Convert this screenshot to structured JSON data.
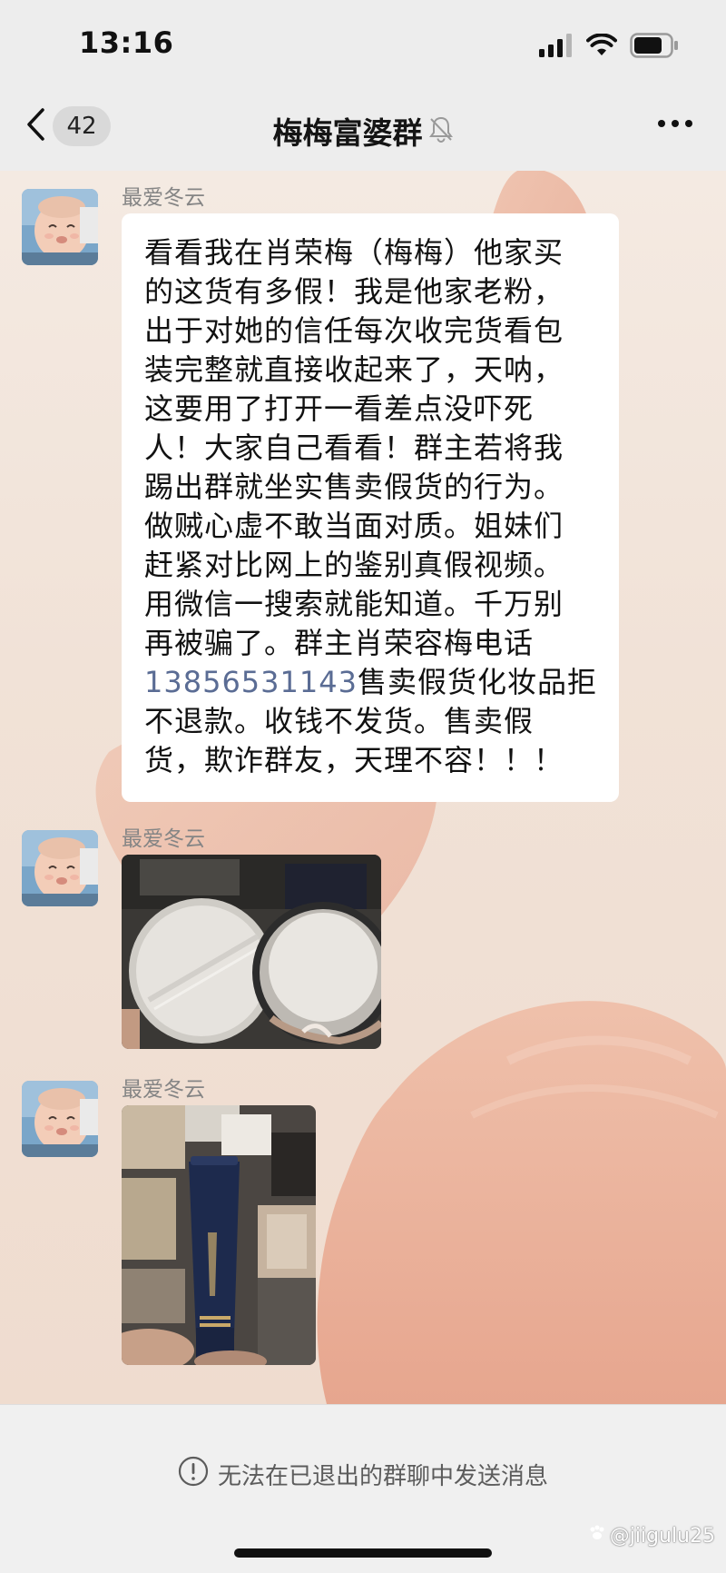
{
  "status_bar": {
    "time": "13:16"
  },
  "nav": {
    "back_count": "42",
    "title": "梅梅富婆群"
  },
  "messages": [
    {
      "sender": "最爱冬云",
      "type": "text",
      "lines": [
        "看看我在肖荣梅（梅梅）他家买",
        "的这货有多假！我是他家老粉，",
        "出于对她的信任每次收完货看包",
        "装完整就直接收起来了，天呐，",
        "这要用了打开一看差点没吓死",
        "人！大家自己看看！群主若将我",
        "踢出群就坐实售卖假货的行为。",
        "做贼心虚不敢当面对质。姐妹们",
        "赶紧对比网上的鉴别真假视频。",
        "用微信一搜索就能知道。千万别",
        "再被骗了。群主肖荣容梅电话"
      ],
      "phone": "13856531143",
      "phone_suffix": "售卖假货化妆品拒",
      "tail_lines": [
        "不退款。收钱不发货。售卖假",
        "货，欺诈群友，天理不容！！！"
      ]
    },
    {
      "sender": "最爱冬云",
      "type": "image",
      "image_icon": "cosmetic-jars-photo"
    },
    {
      "sender": "最爱冬云",
      "type": "image",
      "image_icon": "cosmetics-box-photo"
    }
  ],
  "bottom": {
    "notice": "无法在已退出的群聊中发送消息",
    "watermark": "@jiigulu25"
  },
  "colors": {
    "header_bg": "#ededed",
    "bubble_bg": "#ffffff",
    "phone_link": "#5a6c94",
    "name_gray": "#858585"
  }
}
